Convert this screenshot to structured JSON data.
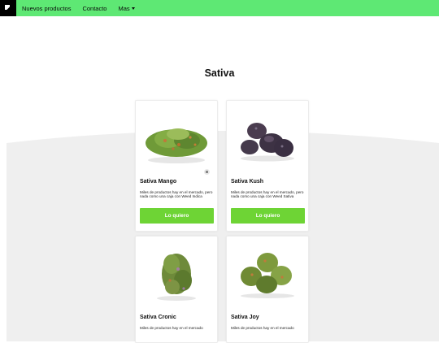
{
  "nav": {
    "items": [
      "Nuevos productos",
      "Contacto"
    ],
    "more_label": "Mas"
  },
  "section": {
    "title": "Sativa"
  },
  "colors": {
    "nav_bg": "#5ee874",
    "button_bg": "#6ed435",
    "bg_wave": "#efefef"
  },
  "products": [
    {
      "name": "Sativa Mango",
      "desc": "Miles de productos hay en el mercado, pero nada como una caja con Weed Indica",
      "button": "Lo quiero"
    },
    {
      "name": "Sativa Kush",
      "desc": "Miles de productos hay en el mercado, pero nada como una caja con Weed Sativa",
      "button": "Lo quiero"
    },
    {
      "name": "Sativa Cronic",
      "desc": "Miles de productos hay en el mercado",
      "button": ""
    },
    {
      "name": "Sativa Joy",
      "desc": "Miles de productos hay en el mercado",
      "button": ""
    }
  ]
}
